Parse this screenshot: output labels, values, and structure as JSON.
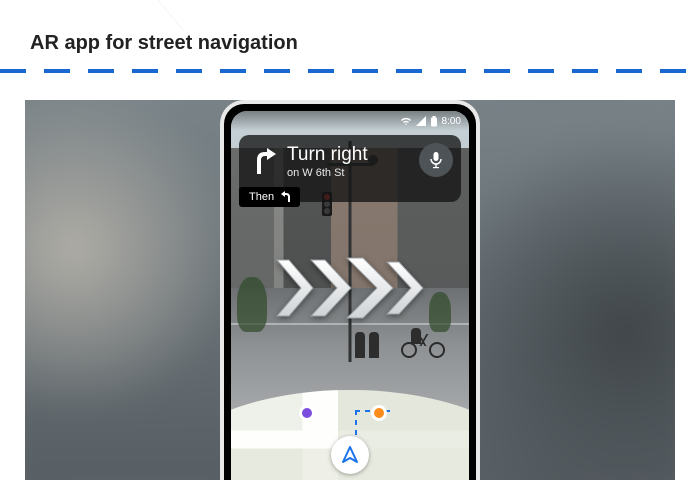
{
  "heading": "AR app for street navigation",
  "statusbar": {
    "time": "8:00"
  },
  "nav": {
    "instruction": "Turn right",
    "street": "on W 6th St",
    "then_label": "Then"
  },
  "icons": {
    "wifi": "wifi-icon",
    "signal": "cell-signal-icon",
    "battery": "battery-icon",
    "mic": "mic-icon",
    "turn_right": "turn-right-arrow-icon",
    "then": "turn-left-arrow-icon",
    "cursor": "navigation-cursor-icon",
    "pin_store": "store-pin-icon",
    "pin_food": "food-pin-icon"
  },
  "colors": {
    "accent": "#1967d2",
    "route": "#1a73e8",
    "pin_purple": "#7b4ddf",
    "pin_orange": "#ff8c1a"
  }
}
